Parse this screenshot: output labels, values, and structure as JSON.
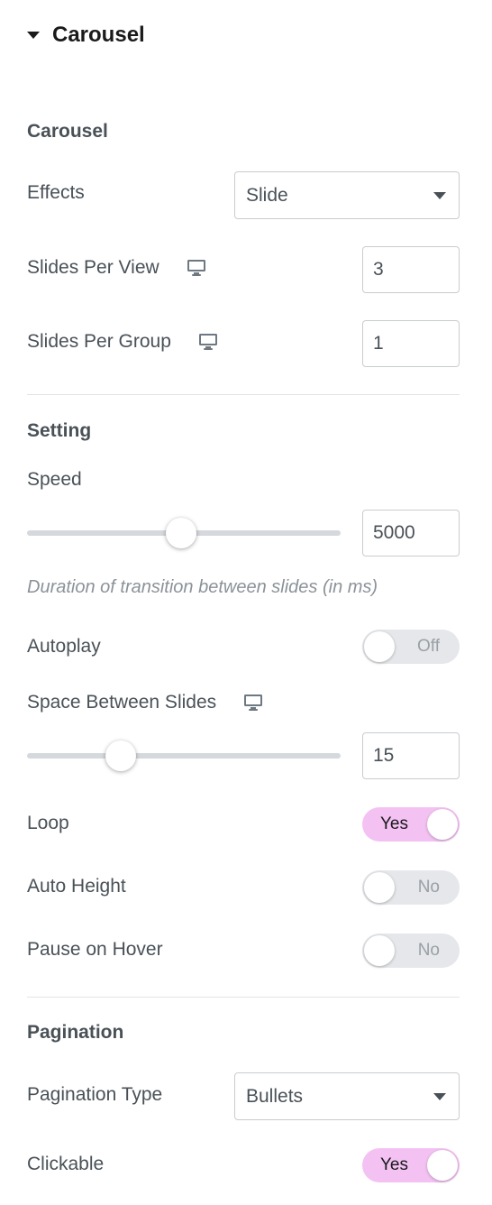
{
  "panel": {
    "title": "Carousel",
    "title_icon": "caret-down-icon"
  },
  "carousel_group": {
    "heading": "Carousel",
    "effects": {
      "label": "Effects",
      "value": "Slide"
    },
    "slides_per_view": {
      "label": "Slides Per View",
      "value": "3",
      "icon": "desktop-icon"
    },
    "slides_per_group": {
      "label": "Slides Per Group",
      "value": "1",
      "icon": "desktop-icon"
    }
  },
  "setting_group": {
    "heading": "Setting",
    "speed": {
      "label": "Speed",
      "value": "5000",
      "slider_fraction": 0.49
    },
    "speed_hint": "Duration of transition between slides (in ms)",
    "autoplay": {
      "label": "Autoplay",
      "state": "Off"
    },
    "space_between": {
      "label": "Space Between Slides",
      "value": "15",
      "icon": "desktop-icon",
      "slider_fraction": 0.3
    },
    "loop": {
      "label": "Loop",
      "state": "Yes"
    },
    "auto_height": {
      "label": "Auto Height",
      "state": "No"
    },
    "pause_on_hover": {
      "label": "Pause on Hover",
      "state": "No"
    }
  },
  "pagination_group": {
    "heading": "Pagination",
    "type": {
      "label": "Pagination Type",
      "value": "Bullets"
    },
    "clickable": {
      "label": "Clickable",
      "state": "Yes"
    }
  },
  "colors": {
    "switch_on": "#f3c2f3",
    "switch_off": "#e5e7ea",
    "text": "#495157",
    "heading": "#1a1a1a"
  }
}
